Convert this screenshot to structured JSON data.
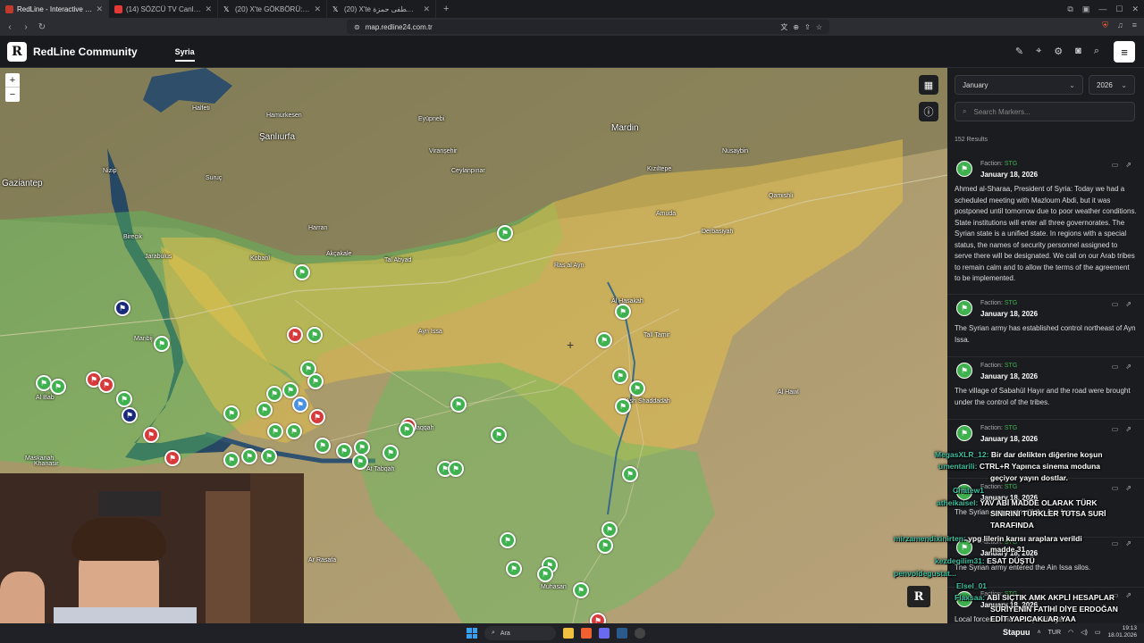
{
  "browser": {
    "tabs": [
      {
        "title": "RedLine - Interactive Strategic M",
        "active": true,
        "color": "#c0392b"
      },
      {
        "title": "(14) SÖZCÜ TV Canlı Yayını ᴴᴰ - It",
        "active": false,
        "color": "#e53935"
      },
      {
        "title": "(20) X'te GÖKBÖRÜ: \"100 bin kişi",
        "active": false,
        "color": "#000000"
      },
      {
        "title": "(20) X'te المصطفى حمزة: \"Update: B",
        "active": false,
        "color": "#000000"
      }
    ],
    "new_tab": "+",
    "url": "map.redline24.com.tr"
  },
  "header": {
    "logo_letter": "R",
    "brand": "RedLine Community",
    "nav_active": "Syria"
  },
  "map": {
    "zoom_in": "+",
    "zoom_out": "−",
    "labels": [
      {
        "text": "Gaziantep",
        "big": true
      },
      {
        "text": "Şanlıurfa",
        "big": true
      },
      {
        "text": "Mardin",
        "big": true
      },
      {
        "text": "Nizip"
      },
      {
        "text": "Suruç"
      },
      {
        "text": "Harran"
      },
      {
        "text": "Viranşehir"
      },
      {
        "text": "Kızıltepe"
      },
      {
        "text": "Nusaybin"
      },
      {
        "text": "Ceylanpınar"
      },
      {
        "text": "Al Hasakah"
      },
      {
        "text": "Ar Raqqah"
      },
      {
        "text": "Ash Shaddadah"
      },
      {
        "text": "Tall Tamir"
      },
      {
        "text": "Ayn Issa"
      },
      {
        "text": "Manbij"
      },
      {
        "text": "Al Bab"
      },
      {
        "text": "Kobanî"
      },
      {
        "text": "Qamishli"
      },
      {
        "text": "Amuda"
      },
      {
        "text": "Derbasiyah"
      },
      {
        "text": "Ras al Ayn"
      },
      {
        "text": "Tal Abyad"
      },
      {
        "text": "Maskanah"
      },
      {
        "text": "At Tabqah"
      },
      {
        "text": "Khanasir"
      },
      {
        "text": "Ar Rasafa"
      },
      {
        "text": "Muhasan"
      },
      {
        "text": "Al Hawl"
      },
      {
        "text": "Hamurkesen"
      },
      {
        "text": "Eyüpnebi"
      },
      {
        "text": "Birecik"
      },
      {
        "text": "Halfeti"
      },
      {
        "text": "Jarabulus"
      },
      {
        "text": "Akçakale"
      }
    ]
  },
  "sidebar": {
    "month": "January",
    "year": "2026",
    "search_placeholder": "Search Markers...",
    "results": "152 Results",
    "cards": [
      {
        "faction_label": "Faction:",
        "faction": "STG",
        "date": "January 18, 2026",
        "text": "Ahmed al-Sharaa, President of Syria: Today we had a scheduled meeting with Mazloum Abdi, but it was postponed until tomorrow due to poor weather conditions. State institutions will enter all three governorates. The Syrian state is a unified state. In regions with a special status, the names of security personnel assigned to serve there will be designated. We call on our Arab tribes to remain calm and to allow the terms of the agreement to be implemented."
      },
      {
        "faction_label": "Faction:",
        "faction": "STG",
        "date": "January 18, 2026",
        "text": "The Syrian army has established control northeast of Ayn Issa."
      },
      {
        "faction_label": "Faction:",
        "faction": "STG",
        "date": "January 18, 2026",
        "text": "The village of Sabahül Hayır and the road were brought under the control of the tribes."
      },
      {
        "faction_label": "Faction:",
        "faction": "STG",
        "date": "January 18, 2026",
        "text": ""
      },
      {
        "faction_label": "Faction:",
        "faction": "STG",
        "date": "January 18, 2026",
        "text": "The Syrian army entered the Ayn Issa..."
      },
      {
        "faction_label": "Faction:",
        "faction": "STG",
        "date": "January 18, 2026",
        "text": "The Syrian army entered the Ain Issa silos."
      },
      {
        "faction_label": "Faction:",
        "faction": "STG",
        "date": "January 18, 2026",
        "text": "Local forces ... Mahmudiye village."
      }
    ]
  },
  "chat": [
    {
      "user": "MegasXLR_12:",
      "msg": "Bir dar delikten diğerine koşun"
    },
    {
      "user": "umentarili:",
      "msg": "CTRL+R Yapınca sinema moduna"
    },
    {
      "user": "",
      "msg": "geçiyor yayın dostlar."
    },
    {
      "user": "Chatew1",
      "msg": ""
    },
    {
      "user": "atheikaisel:",
      "msg": "YAV ABİ MADDE OLARAK TÜRK"
    },
    {
      "user": "",
      "msg": "SINIRINI TÜRKLER TUTSA SURİ"
    },
    {
      "user": "",
      "msg": "TARAFINDA"
    },
    {
      "user": "mirzamendixinirten:",
      "msg": "ypg lilerin karısı araplara verildi"
    },
    {
      "user": "",
      "msg": "madde 31"
    },
    {
      "user": "kezdegilim31:",
      "msg": "ESAT DÜŞTÜ"
    },
    {
      "user": "penvoldegustat...",
      "msg": ""
    },
    {
      "user": "Elsel_01",
      "msg": ""
    },
    {
      "user": "Flaxsaa:",
      "msg": "ABİ SIÇTIK AMK AKPLİ HESAPLAR"
    },
    {
      "user": "",
      "msg": "SURİYENİN FATİHİ DİYE ERDOĞAN"
    },
    {
      "user": "",
      "msg": "EDİT YAPICAKLAR YAA"
    }
  ],
  "taskbar": {
    "search": "Ara",
    "lang": "TUR",
    "time": "19:13",
    "date": "18.01.2026",
    "stream_user": "Stapuu"
  }
}
